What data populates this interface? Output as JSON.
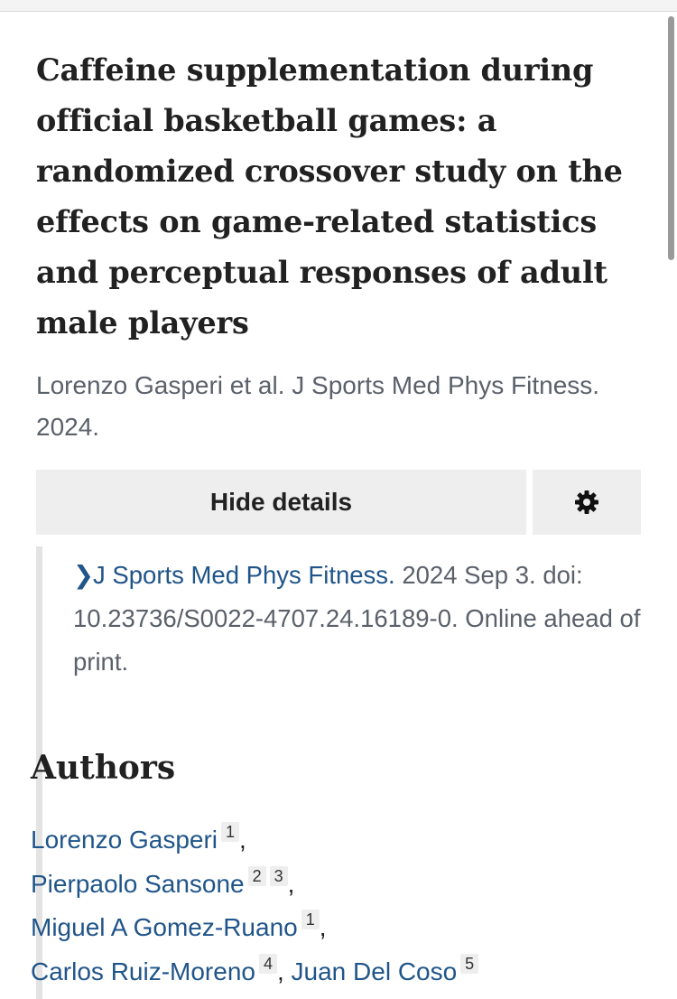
{
  "article": {
    "title": "Caffeine supplementation during official basketball games: a randomized crossover study on the effects on game-related statistics and perceptual responses of adult male players",
    "short_citation": "Lorenzo Gasperi et al. J Sports Med Phys Fitness. 2024."
  },
  "details": {
    "hide_button_label": "Hide details",
    "settings_icon": "gear-icon",
    "journal_link": "J Sports Med Phys Fitness.",
    "pub_date": "2024 Sep 3.",
    "doi": "doi: 10.23736/S0022-4707.24.16189-0.",
    "status": "Online ahead of print."
  },
  "authors": {
    "heading": "Authors",
    "list": [
      {
        "name": "Lorenzo Gasperi",
        "affiliations": [
          "1"
        ]
      },
      {
        "name": "Pierpaolo Sansone",
        "affiliations": [
          "2",
          "3"
        ]
      },
      {
        "name": "Miguel A Gomez-Ruano",
        "affiliations": [
          "1"
        ]
      },
      {
        "name": "Carlos Ruiz-Moreno",
        "affiliations": [
          "4"
        ]
      },
      {
        "name": "Juan Del Coso",
        "affiliations": [
          "5"
        ]
      }
    ]
  },
  "colors": {
    "link": "#20558a",
    "muted_text": "#5b616b",
    "button_bg": "#eeeeee"
  }
}
